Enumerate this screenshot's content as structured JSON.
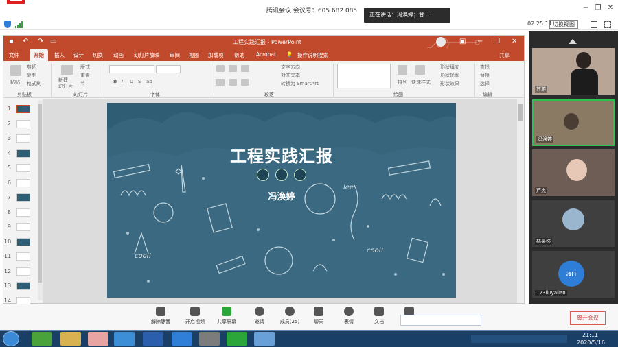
{
  "meeting": {
    "title": "腾讯会议 会议号：605 682 085",
    "speaking_toast": "正在讲话：冯涣婷；甘..."
  },
  "window_controls": {
    "minimize": "−",
    "restore": "❐",
    "close": "✕"
  },
  "statusbar": {
    "timer": "02:25:11",
    "switch_view": "切换视图"
  },
  "powerpoint": {
    "doc_title": "工程实践汇报 - PowerPoint",
    "tabs": [
      "文件",
      "开始",
      "插入",
      "设计",
      "切换",
      "动画",
      "幻灯片放映",
      "审阅",
      "视图",
      "加载项",
      "帮助",
      "Acrobat",
      "操作说明搜索",
      "共享"
    ],
    "active_tab": "开始",
    "ribbon": {
      "clipboard": {
        "paste": "粘贴",
        "cut": "剪切",
        "copy": "复制",
        "format_painter": "格式刷",
        "label": "剪贴板"
      },
      "slides": {
        "new_slide": "新建\n幻灯片",
        "layout": "版式",
        "reset": "重置",
        "section": "节",
        "label": "幻灯片"
      },
      "font": {
        "label": "字体",
        "bold": "B",
        "italic": "I",
        "underline": "U",
        "strike": "S",
        "shadow": "ab"
      },
      "paragraph": {
        "label": "段落",
        "text_direction": "文字方向",
        "align_text": "对齐文本",
        "smartart": "转换为 SmartArt"
      },
      "drawing": {
        "arrange": "排列",
        "quick_styles": "快速样式",
        "fill": "形状填充",
        "outline": "形状轮廓",
        "effects": "形状效果",
        "label": "绘图"
      },
      "editing": {
        "find": "查找",
        "replace": "替换",
        "select": "选择",
        "label": "编辑"
      }
    },
    "thumbnails": [
      "1",
      "2",
      "3",
      "4",
      "5",
      "6",
      "7",
      "8",
      "9",
      "10",
      "11",
      "12",
      "13",
      "14"
    ],
    "slide": {
      "title": "工程实践汇报",
      "author": "冯涣婷",
      "doodle_words": [
        "cool!",
        "lee",
        "cool!"
      ]
    }
  },
  "participants": [
    {
      "name": "甘游",
      "mic": "on"
    },
    {
      "name": "冯涣婷",
      "mic": "on"
    },
    {
      "name": "芦杰",
      "mic": "off"
    },
    {
      "name": "林昊然",
      "mic": "off"
    },
    {
      "name": "123liuyalian",
      "mic": "off",
      "avatar": "an"
    }
  ],
  "toolbar": {
    "items": [
      "解除静音",
      "开启视频",
      "共享屏幕",
      "邀请",
      "成员(25)",
      "聊天",
      "表情",
      "文档",
      "应用"
    ],
    "leave": "离开会议"
  },
  "taskbar": {
    "time": "21:11",
    "date": "2020/5/16"
  },
  "colors": {
    "ppt_accent": "#c14a2c",
    "slide_bg": "#2f5d74",
    "leave": "#d63b3b",
    "taskbar": "#1a3f66"
  }
}
